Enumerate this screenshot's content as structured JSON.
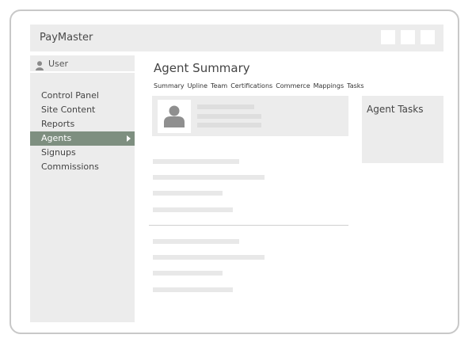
{
  "app": {
    "title": "PayMaster"
  },
  "user": {
    "label": "User",
    "icon": "user-icon"
  },
  "sidebar": {
    "items": [
      {
        "label": "Control Panel",
        "active": false
      },
      {
        "label": "Site Content",
        "active": false
      },
      {
        "label": "Reports",
        "active": false
      },
      {
        "label": "Agents",
        "active": true
      },
      {
        "label": "Signups",
        "active": false
      },
      {
        "label": "Commissions",
        "active": false
      }
    ]
  },
  "main": {
    "title": "Agent Summary",
    "tabs": [
      "Summary",
      "Upline",
      "Team",
      "Certifications",
      "Commerce",
      "Mappings",
      "Tasks"
    ]
  },
  "tasks_panel": {
    "title": "Agent Tasks"
  },
  "colors": {
    "accent": "#7e8f80",
    "panel": "#ececec",
    "placeholder": "#e8e8e8"
  }
}
